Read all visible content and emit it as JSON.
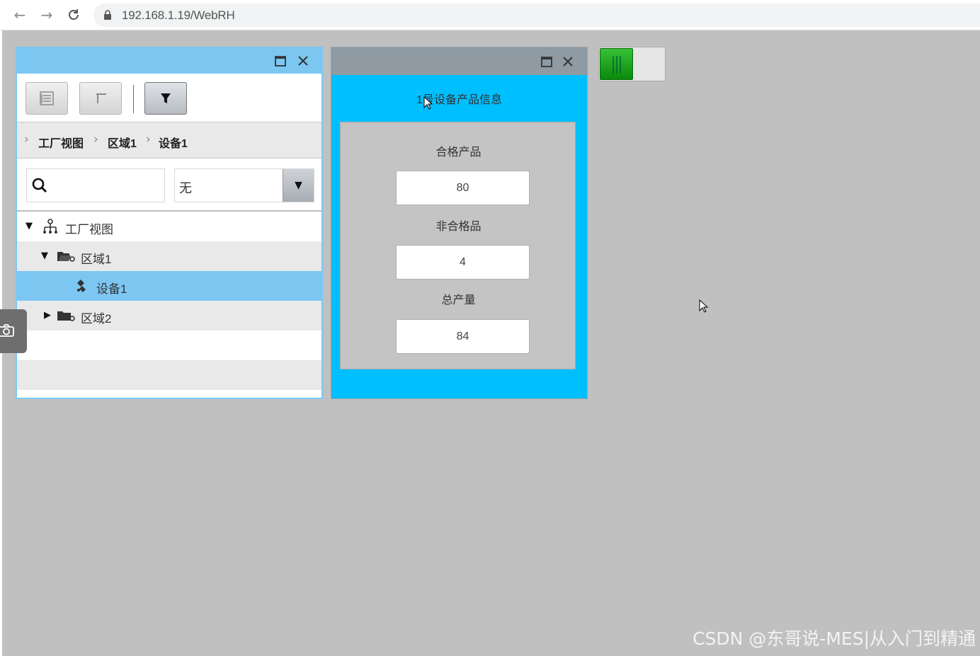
{
  "browser": {
    "url": "192.168.1.19/WebRH",
    "back_icon": "arrow-left-icon",
    "forward_icon": "arrow-right-icon",
    "reload_icon": "reload-icon"
  },
  "tree_panel": {
    "toolbar": [
      "expand-list-icon",
      "collapse-icon",
      "filter-icon"
    ],
    "breadcrumb": [
      "工厂视图",
      "区域1",
      "设备1"
    ],
    "search": {
      "value": "",
      "placeholder": ""
    },
    "filter_select": {
      "value": "无"
    },
    "tree": [
      {
        "label": "工厂视图",
        "level": 0,
        "expanded": true,
        "selected": false
      },
      {
        "label": "区域1",
        "level": 1,
        "expanded": true,
        "selected": false
      },
      {
        "label": "设备1",
        "level": 2,
        "expanded": false,
        "selected": true
      },
      {
        "label": "区域2",
        "level": 1,
        "expanded": false,
        "selected": false
      }
    ]
  },
  "info_panel": {
    "heading": "1号设备产品信息",
    "fields": [
      {
        "label": "合格产品",
        "value": "80"
      },
      {
        "label": "非合格品",
        "value": "4"
      },
      {
        "label": "总产量",
        "value": "84"
      }
    ]
  },
  "toggle": {
    "state": "on"
  },
  "watermark": "CSDN @东哥说-MES|从入门到精通",
  "colors": {
    "tree_title": "#7cc7f2",
    "info_bg": "#00bfff",
    "info_title": "#8f9aa3",
    "selected_row": "#7cc7f2",
    "toggle_on": "#1aa31a",
    "canvas": "#c0c0c0"
  }
}
